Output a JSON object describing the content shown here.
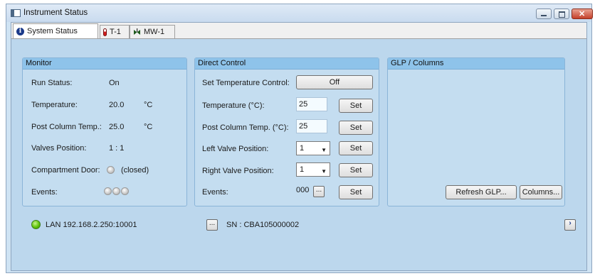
{
  "window": {
    "title": "Instrument Status"
  },
  "tabs": [
    {
      "label": "System Status",
      "icon": "info-icon"
    },
    {
      "label": "T-1",
      "icon": "thermometer-icon"
    },
    {
      "label": "MW-1",
      "icon": "valve-icon"
    }
  ],
  "monitor": {
    "header": "Monitor",
    "run_status_label": "Run Status:",
    "run_status_value": "On",
    "temperature_label": "Temperature:",
    "temperature_value": "20.0",
    "temperature_unit": "°C",
    "post_column_label": "Post Column Temp.:",
    "post_column_value": "25.0",
    "post_column_unit": "°C",
    "valves_label": "Valves Position:",
    "valves_value": "1 : 1",
    "door_label": "Compartment Door:",
    "door_value": "(closed)",
    "events_label": "Events:"
  },
  "direct_control": {
    "header": "Direct Control",
    "set_temp_control_label": "Set Temperature Control:",
    "set_temp_control_button": "Off",
    "temperature_label": "Temperature (°C):",
    "temperature_input": "25",
    "post_column_label": "Post Column Temp. (°C):",
    "post_column_input": "25",
    "left_valve_label": "Left Valve Position:",
    "left_valve_value": "1",
    "right_valve_label": "Right Valve Position:",
    "right_valve_value": "1",
    "events_label": "Events:",
    "events_value": "000",
    "more_button": "...",
    "set_button": "Set"
  },
  "glp": {
    "header": "GLP / Columns",
    "refresh_button": "Refresh GLP...",
    "columns_button": "Columns..."
  },
  "footer": {
    "connection": "LAN 192.168.2.250:10001",
    "more_button": "...",
    "serial": "SN :  CBA105000002",
    "status_color": "#5fc40a"
  }
}
